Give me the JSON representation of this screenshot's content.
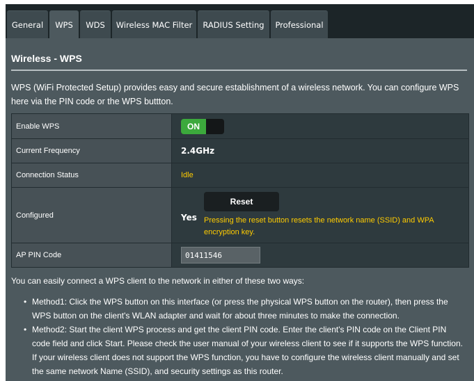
{
  "tabs": [
    {
      "label": "General",
      "active": false
    },
    {
      "label": "WPS",
      "active": true
    },
    {
      "label": "WDS",
      "active": false
    },
    {
      "label": "Wireless MAC Filter",
      "active": false
    },
    {
      "label": "RADIUS Setting",
      "active": false
    },
    {
      "label": "Professional",
      "active": false
    }
  ],
  "page": {
    "title": "Wireless - WPS",
    "intro": "WPS (WiFi Protected Setup) provides easy and secure establishment of a wireless network. You can configure WPS here via the PIN code or the WPS buttton."
  },
  "form": {
    "enable_wps": {
      "label": "Enable WPS",
      "toggle_text": "ON"
    },
    "current_frequency": {
      "label": "Current Frequency",
      "value": "2.4GHz"
    },
    "connection_status": {
      "label": "Connection Status",
      "value": "Idle"
    },
    "configured": {
      "label": "Configured",
      "value": "Yes",
      "reset_label": "Reset",
      "reset_note": "Pressing the reset button resets the network name (SSID) and WPA encryption key."
    },
    "ap_pin": {
      "label": "AP PIN Code",
      "value": "01411546"
    }
  },
  "howto": {
    "lead": "You can easily connect a WPS client to the network in either of these two ways:",
    "methods": [
      "Method1: Click the WPS button on this interface (or press the physical WPS button on the router), then press the WPS button on the client's WLAN adapter and wait for about three minutes to make the connection.",
      "Method2: Start the client WPS process and get the client PIN code. Enter the client's PIN code on the Client PIN code field and click Start. Please check the user manual of your wireless client to see if it supports the WPS function. If your wireless client does not support the WPS function, you have to configure the wireless client manually and set the same network Name (SSID), and security settings as this router."
    ]
  },
  "colors": {
    "panel": "#4d595e",
    "tab": "#3e4a4f",
    "toggle_on": "#3ca93c",
    "status_text": "#ffcc00"
  }
}
